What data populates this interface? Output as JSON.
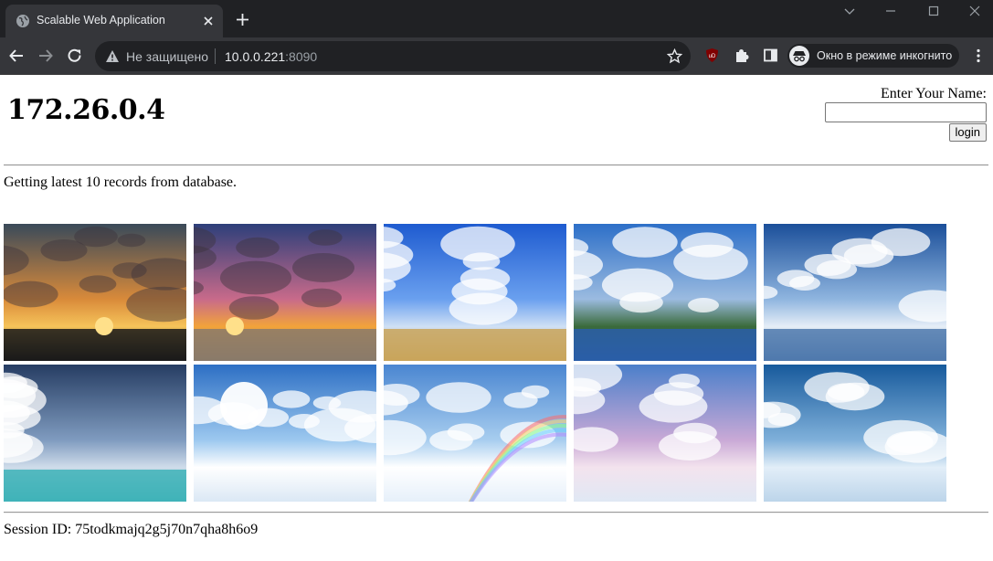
{
  "browser": {
    "tab_title": "Scalable Web Application",
    "security_label": "Не защищено",
    "url_host": "10.0.0.221",
    "url_port": ":8090",
    "incognito_label": "Окно в режиме инкогнито",
    "icons": [
      "globe-icon",
      "close-icon",
      "plus-icon",
      "back-arrow-icon",
      "forward-arrow-icon",
      "reload-icon",
      "warning-icon",
      "star-icon",
      "ublock-icon",
      "puzzle-icon",
      "sidepanel-icon",
      "incognito-icon",
      "kebab-menu-icon"
    ]
  },
  "page": {
    "host_title": "172.26.0.4",
    "login_label": "Enter Your Name:",
    "login_button": "login",
    "name_value": "",
    "status_text": "Getting latest 10 records from database.",
    "session_text": "Session ID: 75todkmajq2g5j70n7qha8h6o9"
  },
  "gallery": {
    "images": [
      {
        "name": "sunset-clouds-image",
        "sky_top": "#3a4a5a",
        "sky_mid": "#d98a3a",
        "horizon": "#f6c45a",
        "ground": "#1a1a1a"
      },
      {
        "name": "beach-sunset-image",
        "sky_top": "#2d3f7a",
        "sky_mid": "#c86a8a",
        "horizon": "#f2a33a",
        "ground": "#8a7a6a"
      },
      {
        "name": "road-blue-sky-image",
        "sky_top": "#1e5bd0",
        "sky_mid": "#6aa0ef",
        "horizon": "#cfe0f5",
        "ground": "#c9a45a"
      },
      {
        "name": "lake-reflection-image",
        "sky_top": "#2d6fc8",
        "sky_mid": "#9bbbe0",
        "horizon": "#3a6a3a",
        "ground": "#2a5ea8"
      },
      {
        "name": "pier-clouds-image",
        "sky_top": "#1b4f9a",
        "sky_mid": "#8fb5df",
        "horizon": "#e6eef7",
        "ground": "#4f79ad"
      },
      {
        "name": "tropical-water-image",
        "sky_top": "#263d63",
        "sky_mid": "#7f9bbf",
        "horizon": "#cfdcea",
        "ground": "#3fb3b8"
      },
      {
        "name": "sun-rays-clouds-image",
        "sky_top": "#2d6fc4",
        "sky_mid": "#9cc8ef",
        "horizon": "#ffffff",
        "ground": "#dbe8f5"
      },
      {
        "name": "rainbow-clouds-image",
        "sky_top": "#4a86d1",
        "sky_mid": "#a7cdef",
        "horizon": "#ffffff",
        "ground": "#e6f0fa"
      },
      {
        "name": "pink-sky-clouds-image",
        "sky_top": "#4b7fca",
        "sky_mid": "#c9a9d6",
        "horizon": "#f3e3ee",
        "ground": "#e0e8f4"
      },
      {
        "name": "cloud-tower-image",
        "sky_top": "#175a9c",
        "sky_mid": "#7fb0da",
        "horizon": "#e2eef8",
        "ground": "#bdd5ea"
      }
    ]
  },
  "colors": {
    "chrome_dark": "#202124",
    "chrome_toolbar": "#35363a",
    "chrome_text": "#e8eaed"
  }
}
